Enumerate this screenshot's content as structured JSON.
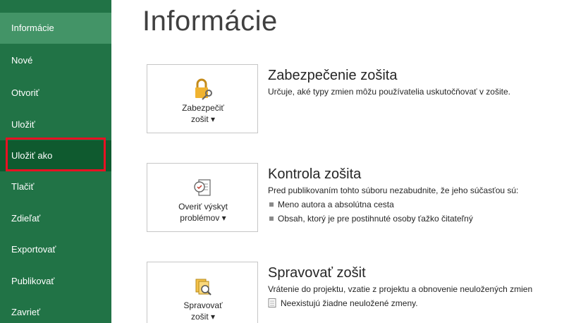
{
  "sidebar": {
    "items": [
      {
        "label": "Informácie"
      },
      {
        "label": "Nové"
      },
      {
        "label": "Otvoriť"
      },
      {
        "label": "Uložiť"
      },
      {
        "label": "Uložiť ako"
      },
      {
        "label": "Tlačiť"
      },
      {
        "label": "Zdieľať"
      },
      {
        "label": "Exportovať"
      },
      {
        "label": "Publikovať"
      },
      {
        "label": "Zavrieť"
      }
    ],
    "accent_color": "#217346"
  },
  "main": {
    "title": "Informácie",
    "sections": [
      {
        "button_line1": "Zabezpečiť",
        "button_line2": "zošit ▾",
        "button_icon": "lock-key-icon",
        "heading": "Zabezpečenie zošita",
        "description": "Určuje, aké typy zmien môžu používatelia uskutočňovať v zošite."
      },
      {
        "button_line1": "Overiť výskyt",
        "button_line2": "problémov ▾",
        "button_icon": "inspect-document-icon",
        "heading": "Kontrola zošita",
        "description": "Pred publikovaním tohto súboru nezabudnite, že jeho súčasťou sú:",
        "bullets": [
          "Meno autora a absolútna cesta",
          "Obsah, ktorý je pre postihnuté osoby ťažko čitateľný"
        ]
      },
      {
        "button_line1": "Spravovať",
        "button_line2": "zošit ▾",
        "button_icon": "manage-workbook-icon",
        "heading": "Spravovať zošit",
        "description": "Vrátenie do projektu, vzatie z projektu a obnovenie neuložených zmien",
        "bullets": [
          "Neexistujú žiadne neuložené zmeny."
        ]
      }
    ]
  }
}
